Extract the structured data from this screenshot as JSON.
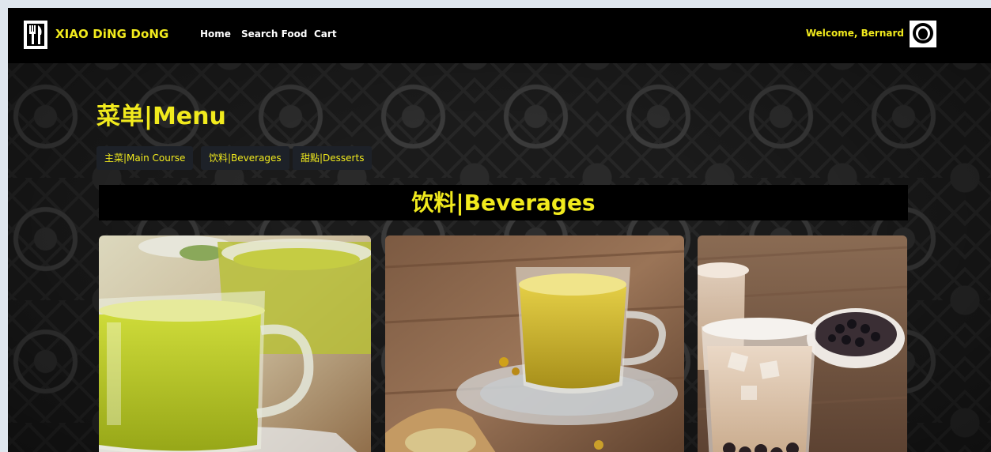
{
  "navbar": {
    "brand": "XIAO DiNG DoNG",
    "links": [
      "Home",
      "Search Food",
      "Cart"
    ],
    "welcome": "Welcome, Bernard",
    "logo_icon": "fork-knife-icon",
    "avatar_icon": "user-avatar-icon"
  },
  "menu": {
    "title": "菜单|Menu",
    "tabs": [
      "主菜|Main Course",
      "饮料|Beverages",
      "甜點|Desserts"
    ]
  },
  "section": {
    "title": "饮料|Beverages"
  },
  "colors": {
    "accent": "#f1ea1d",
    "navbar_bg": "#000000",
    "tab_bg": "#1d2128"
  }
}
